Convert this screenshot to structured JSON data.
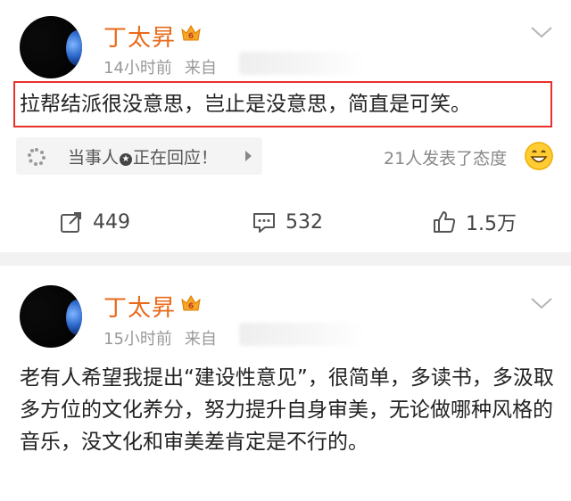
{
  "post1": {
    "author": "丁太昇",
    "time": "14小时前",
    "source_prefix": "来自",
    "text": "拉帮结派很没意思，岂止是没意思，简直是可笑。",
    "topic": {
      "before_icon": "当事人",
      "after_icon": "正在回应！"
    },
    "attitude_text": "21人发表了态度",
    "actions": {
      "share": "449",
      "comment": "532",
      "like": "1.5万"
    }
  },
  "post2": {
    "author": "丁太昇",
    "time": "15小时前",
    "source_prefix": "来自",
    "text": "老有人希望我提出“建设性意见”，很简单，多读书，多汲取多方位的文化养分，努力提升自身审美，无论做哪种风格的音乐，没文化和审美差肯定是不行的。"
  },
  "colors": {
    "name": "#e86a1a",
    "highlight_border": "#e8312b",
    "separator": "#f2f2f2"
  },
  "icons": [
    "vip-crown-icon",
    "chevron-down-icon",
    "topic-spinner-icon",
    "arrow-right-icon",
    "grin-emoji-icon",
    "share-icon",
    "comment-icon",
    "like-icon"
  ]
}
